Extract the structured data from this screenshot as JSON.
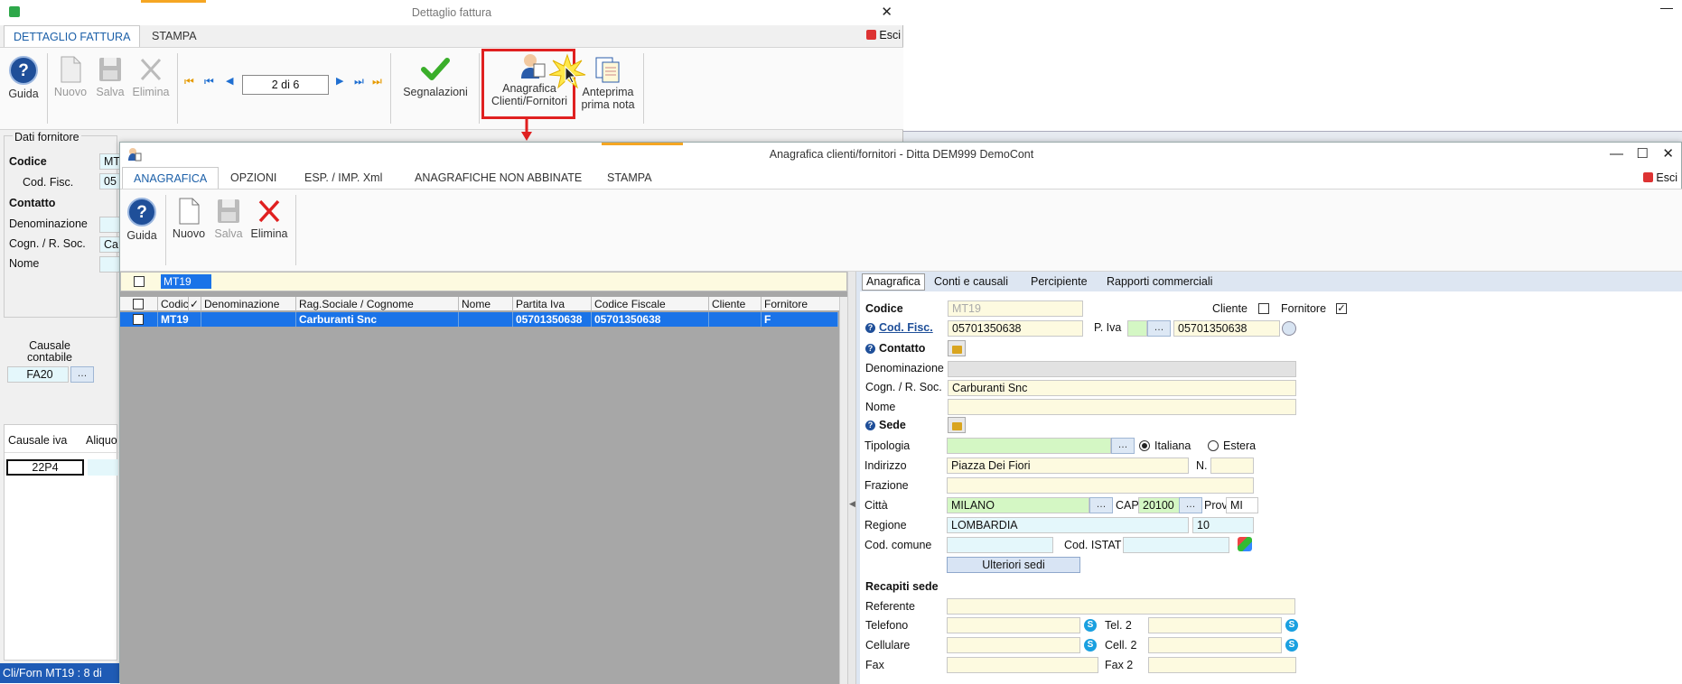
{
  "back_window": {
    "title": "Dettaglio fattura",
    "tabs": [
      "DETTAGLIO FATTURA",
      "STAMPA"
    ],
    "exit": "Esci",
    "ribbon": {
      "guida": "Guida",
      "nuovo": "Nuovo",
      "salva": "Salva",
      "elimina": "Elimina",
      "record_nav": "2 di 6",
      "segnalazioni": "Segnalazioni",
      "anagrafica_line1": "Anagrafica",
      "anagrafica_line2": "Clienti/Fornitori",
      "anteprima_line1": "Anteprima",
      "anteprima_line2": "prima nota"
    },
    "section_title": "Dati fornitore",
    "codice_label": "Codice",
    "codice_value": "MT",
    "codfisc_label": "Cod. Fisc.",
    "codfisc_value": "05",
    "contatto_label": "Contatto",
    "denominazione_label": "Denominazione",
    "cogn_label": "Cogn. / R. Soc.",
    "cogn_value": "Ca",
    "nome_label": "Nome",
    "causale_label_1": "Causale",
    "causale_label_2": "contabile",
    "causale_value": "FA20",
    "grid_col1": "Causale iva",
    "grid_col2": "Aliquo",
    "grid_cell": "22P4",
    "status": "Cli/Forn MT19 : 8 di"
  },
  "front_window": {
    "title": "Anagrafica clienti/fornitori - Ditta DEM999 DemoCont",
    "tabs": [
      "ANAGRAFICA",
      "OPZIONI",
      "ESP. / IMP. Xml",
      "ANAGRAFICHE NON ABBINATE",
      "STAMPA"
    ],
    "exit": "Esci",
    "ribbon": {
      "guida": "Guida",
      "nuovo": "Nuovo",
      "salva": "Salva",
      "elimina": "Elimina"
    },
    "filter_value": "MT19",
    "grid": {
      "columns": [
        "Codic",
        "✓",
        "Denominazione",
        "Rag.Sociale / Cognome",
        "Nome",
        "Partita Iva",
        "Codice Fiscale",
        "Cliente",
        "Fornitore"
      ],
      "row": [
        "MT19",
        "",
        "",
        "Carburanti Snc",
        "",
        "05701350638",
        "05701350638",
        "",
        "F"
      ]
    }
  },
  "detail": {
    "subtabs": [
      "Anagrafica",
      "Conti e causali",
      "Percipiente",
      "Rapporti commerciali"
    ],
    "codice_label": "Codice",
    "codice_value": "MT19",
    "cliente_label": "Cliente",
    "fornitore_label": "Fornitore",
    "codfisc_label": "Cod. Fisc.",
    "codfisc_value": "05701350638",
    "piva_label": "P. Iva",
    "piva_value": "05701350638",
    "contatto_label": "Contatto",
    "denominazione_label": "Denominazione",
    "cogn_label": "Cogn. / R. Soc.",
    "cogn_value": "Carburanti Snc",
    "nome_label": "Nome",
    "sede_label": "Sede",
    "tipologia_label": "Tipologia",
    "italiana_label": "Italiana",
    "estera_label": "Estera",
    "indirizzo_label": "Indirizzo",
    "indirizzo_value": "Piazza Dei Fiori",
    "numero_label": "N.",
    "frazione_label": "Frazione",
    "citta_label": "Città",
    "citta_value": "MILANO",
    "cap_label": "CAP",
    "cap_value": "20100",
    "prov_label": "Prov.",
    "prov_value": "MI",
    "regione_label": "Regione",
    "regione_value": "LOMBARDIA",
    "regione_code": "10",
    "codcomune_label": "Cod. comune",
    "codistat_label": "Cod. ISTAT",
    "ulteriori_sedi": "Ulteriori sedi",
    "recapiti_label": "Recapiti sede",
    "referente_label": "Referente",
    "telefono_label": "Telefono",
    "tel2_label": "Tel. 2",
    "cellulare_label": "Cellulare",
    "cell2_label": "Cell. 2",
    "fax_label": "Fax",
    "fax2_label": "Fax 2"
  },
  "colors": {
    "accent": "#f5a623",
    "selection": "#1a73e8",
    "highlight_box": "#e02020"
  }
}
